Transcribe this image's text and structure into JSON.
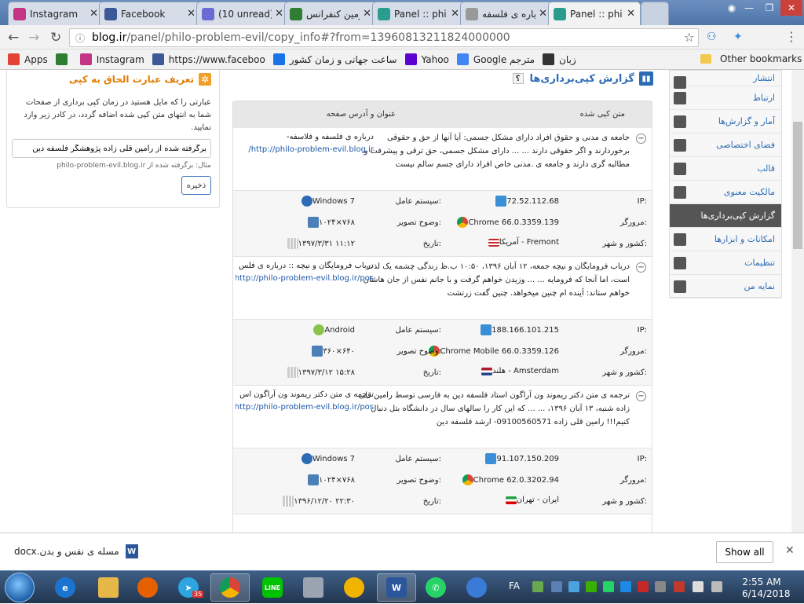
{
  "browser": {
    "tabs": [
      {
        "title": "Instagram",
        "icon": "instagram-icon",
        "color": "#c13584",
        "active": false
      },
      {
        "title": "Facebook",
        "icon": "facebook-icon",
        "color": "#3b5998",
        "active": false
      },
      {
        "title": "(10 unread)",
        "icon": "mail-icon",
        "color": "#6b6bd6",
        "active": false
      },
      {
        "title": "دومین کنفرانس",
        "icon": "conference-icon",
        "color": "#2e7d32",
        "active": false
      },
      {
        "title": "Panel :: phi",
        "icon": "blog-icon",
        "color": "#2a9d8f",
        "active": false
      },
      {
        "title": "درباره ی فلسفه",
        "icon": "page-icon",
        "color": "#999999",
        "active": false
      },
      {
        "title": "Panel :: phi",
        "icon": "blog-icon",
        "color": "#2a9d8f",
        "active": true
      }
    ],
    "url_host": "blog.ir",
    "url_path": "/panel/philo-problem-evil/copy_info#?from=1396081321182400000​0",
    "bookmarks": [
      {
        "label": "Apps",
        "icon": "apps-icon",
        "color": "#e34234"
      },
      {
        "label": "",
        "icon": "green-round-icon",
        "color": "#2e7d32"
      },
      {
        "label": "Instagram",
        "icon": "instagram-icon",
        "color": "#c13584"
      },
      {
        "label": "https://www.faceboo",
        "icon": "facebook-icon",
        "color": "#3b5998"
      },
      {
        "label": "ساعت جهانی و زمان کشور",
        "icon": "clock-site-icon",
        "color": "#1a73e8"
      },
      {
        "label": "Yahoo",
        "icon": "yahoo-icon",
        "color": "#5f01d1"
      },
      {
        "label": "Google مترجم",
        "icon": "translate-icon",
        "color": "#4285f4"
      },
      {
        "label": "زبان",
        "icon": "language-site-icon",
        "color": "#333333"
      }
    ],
    "other_bookmarks": "Other bookmarks"
  },
  "left_panel": {
    "title": "تعریف عبارت الحاق به کپی",
    "description": "عبارتی را که مایل هستید در زمان کپی برداری از صفحات شما به انتهای متن کپی شده اضافه گردد، در کادر زیر وارد نمایید.",
    "input_value": "برگرفته شده از رامین قلی زاده پژوهشگر فلسفه دین",
    "example": "مثال: برگرفته شده از philo-problem-evil.blog.ir",
    "save_label": "ذخیره"
  },
  "page": {
    "title": "گزارش کپی‌برداری‌ها",
    "help": "؟",
    "col_text": "متن کپی شده",
    "col_source": "عنوان و آدرس صفحه"
  },
  "labels": {
    "os": "سیستم عامل:",
    "ip": "IP:",
    "browser": "مرورگر:",
    "resolution": "وضوح تصویر:",
    "location": "کشور و شهر:",
    "date": "تاریخ:"
  },
  "records": [
    {
      "text": "جامعه ی مدنی و حقوق افراد دارای مشکل جسمی: آیا آنها از حق و حقوقی برخوردارند و اگر حقوقی دارند ... ... دارای مشکل جسمی، حق ترقی و پیشرفت و مطالبه گری دارند و جامعه ی .مدنی خاص افراد دارای جسم سالم نیست",
      "source_title": "درباره ی فلسفه و فلاسفه-",
      "source_url": "http://philo-problem-evil.blog.ir/",
      "ip": "72.52.112.68",
      "os": "Windows 7",
      "browser": "Chrome 66.0.3359.139",
      "resolution": "۱۰۲۴×۷۶۸",
      "location": "آمریکا - Fremont",
      "flag": "us-flag",
      "date": "۱۳۹۷/۳/۳۱ ۱۱:۱۲"
    },
    {
      "text": "درباب فرومایگان و نیچه جمعه، ۱۲ آبان ۱۳۹۶، ۱۰:۵۰ ب.ظ زندگی چشمه یک لذت است، اما آنجا که فرومایه ... ... وزیدن خواهم گرفت و با جانم نفس از جان هاشان خواهم ستاند: آینده ام چنین میخواهد. چنین گفت زرتشت",
      "source_title": "درباب فرومایگان و نیچه :: درباره ی فلس",
      "source_url": "http://philo-problem-evil.blog.ir/pos",
      "ip": "188.166.101.215",
      "os": "Android",
      "browser": "Chrome Mobile 66.0.3359.126",
      "resolution": "۳۶۰×۶۴۰",
      "location": "هلند - Amsterdam",
      "flag": "nl-flag",
      "date": "۱۳۹۷/۳/۱۲ ۱۵:۲۸"
    },
    {
      "text": "ترجمه ی متن دکتر ریموند ون آراگون استاد فلسفه دین به فارسی توسط رامین قلی زاده شنبه، ۱۳ آبان ۱۳۹۶، ... ... که این کار را سالهای سال در دانشگاه بتل دنبال کنیم!!! رامین قلی زاده 09100560571- ارشد فلسفه دین",
      "source_title": "ترجمه ی متن دکتر ریموند ون آراگون اس",
      "source_url": "http://philo-problem-evil.blog.ir/pos",
      "ip": "91.107.150.209",
      "os": "Windows 7",
      "browser": "Chrome 62.0.3202.94",
      "resolution": "۱۰۲۴×۷۶۸",
      "location": "ایران - تهران",
      "flag": "ir-flag",
      "date": "۱۳۹۶/۱۲/۲۰ ۲۲:۳۰"
    }
  ],
  "sidebar": {
    "items": [
      {
        "label": "انتشار",
        "icon": "publish-icon",
        "active": false
      },
      {
        "label": "ارتباط",
        "icon": "contact-icon",
        "active": false
      },
      {
        "label": "آمار و گزارش‌ها",
        "icon": "stats-icon",
        "active": false
      },
      {
        "label": "فضای اختصاصی",
        "icon": "space-icon",
        "active": false
      },
      {
        "label": "قالب",
        "icon": "template-icon",
        "active": false
      },
      {
        "label": "مالکیت معنوی",
        "icon": "copyright-icon",
        "active": false
      },
      {
        "label": "گزارش کپی‌برداری‌ها",
        "icon": "copy-report-icon",
        "active": true
      },
      {
        "label": "امکانات و ابزارها",
        "icon": "tools-icon",
        "active": false
      },
      {
        "label": "تنظیمات",
        "icon": "settings-icon",
        "active": false
      },
      {
        "label": "نمایه من",
        "icon": "profile-icon",
        "active": false
      }
    ]
  },
  "download": {
    "filename": "مسله ی نفس و بدن.docx",
    "show_all": "Show all"
  },
  "taskbar": {
    "lang": "FA",
    "time": "2:55 AM",
    "date": "6/14/2018",
    "badge": "35"
  }
}
